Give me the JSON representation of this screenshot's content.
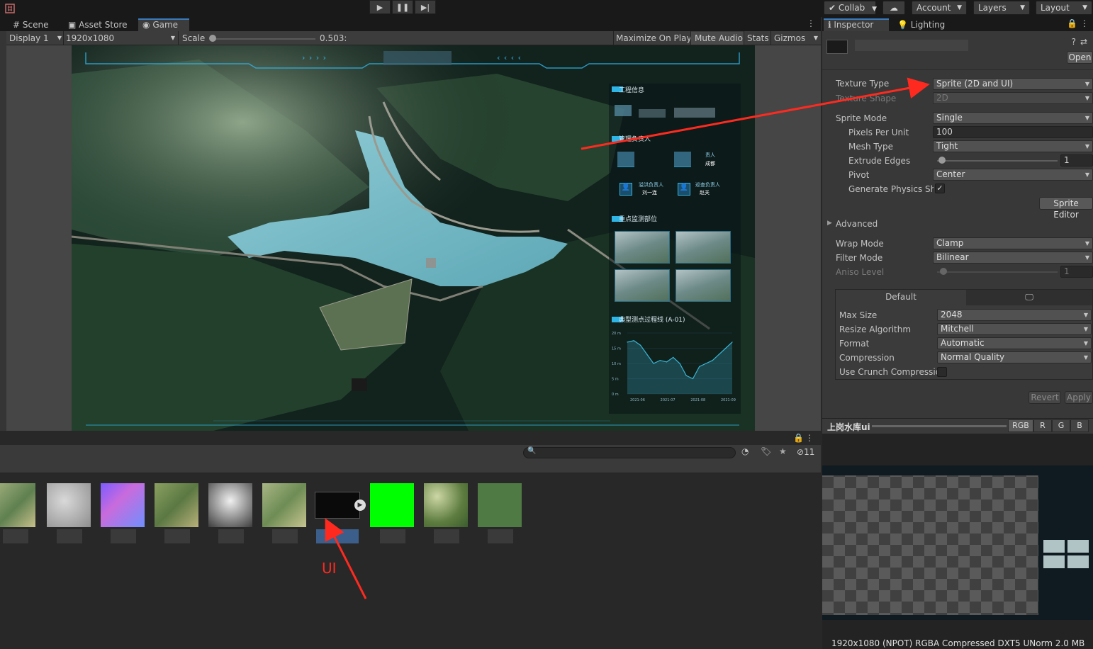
{
  "toolbar": {
    "collab_label": "Collab",
    "account_label": "Account",
    "layers_label": "Layers",
    "layout_label": "Layout",
    "play_icon": "play-icon",
    "pause_icon": "pause-icon",
    "step_icon": "step-icon"
  },
  "scene_tabs": {
    "scene": "Scene",
    "asset_store": "Asset Store",
    "game": "Game"
  },
  "game_bar": {
    "display": "Display 1",
    "resolution": "1920x1080",
    "scale_label": "Scale",
    "scale_value": 0.503,
    "scale_text": "0.503:",
    "maximize": "Maximize On Play",
    "mute": "Mute Audio",
    "stats": "Stats",
    "gizmos": "Gizmos"
  },
  "game_ui": {
    "panel1_title": "工程信息",
    "panel2_title": "管理负责人",
    "panel2_tail": "责人",
    "panel2_tail2": "成都",
    "person1_role": "溢洪负责人",
    "person1_name": "刘一连",
    "person2_role": "巡查负责人",
    "person2_name": "赵关",
    "panel3_title": "重点监测部位",
    "panel4_title": "典型测点过程线 (A-01)",
    "chart_y_ticks": [
      "20 m",
      "15 m",
      "10 m",
      "5 m",
      "0 m"
    ],
    "chart_x_ticks": [
      "2021-06",
      "2021-07",
      "2021-08",
      "2021-09"
    ],
    "header_left_arrows": "› › › ›",
    "header_right_arrows": "‹ ‹ ‹ ‹"
  },
  "chart_data": {
    "type": "area",
    "title": "典型测点过程线 (A-01)",
    "x": [
      "2021-06",
      "2021-07",
      "2021-08",
      "2021-09"
    ],
    "ylim": [
      0,
      20
    ],
    "y_ticks": [
      "20 m",
      "15 m",
      "10 m",
      "5 m",
      "0 m"
    ],
    "series": [
      {
        "values": [
          17,
          17.5,
          16,
          13,
          10,
          11,
          10.5,
          12,
          10,
          6,
          5,
          9,
          10,
          11,
          13,
          15,
          17
        ]
      }
    ],
    "color": "#3ab6d6"
  },
  "inspector_tabs": {
    "inspector": "Inspector",
    "lighting": "Lighting"
  },
  "inspector": {
    "open_label": "Open",
    "texture_type_label": "Texture Type",
    "texture_type_value": "Sprite (2D and UI)",
    "texture_shape_label": "Texture Shape",
    "texture_shape_value": "2D",
    "sprite_mode_label": "Sprite Mode",
    "sprite_mode_value": "Single",
    "ppu_label": "Pixels Per Unit",
    "ppu_value": "100",
    "mesh_type_label": "Mesh Type",
    "mesh_type_value": "Tight",
    "extrude_label": "Extrude Edges",
    "extrude_value": "1",
    "extrude_fraction": 0.03,
    "pivot_label": "Pivot",
    "pivot_value": "Center",
    "gen_physics_label": "Generate Physics Sha",
    "gen_physics_checked": true,
    "sprite_editor_label": "Sprite Editor",
    "advanced_label": "Advanced",
    "wrap_label": "Wrap Mode",
    "wrap_value": "Clamp",
    "filter_label": "Filter Mode",
    "filter_value": "Bilinear",
    "aniso_label": "Aniso Level",
    "aniso_value": "1",
    "aniso_fraction": 0.06,
    "platform_default": "Default",
    "max_size_label": "Max Size",
    "max_size_value": "2048",
    "resize_label": "Resize Algorithm",
    "resize_value": "Mitchell",
    "format_label": "Format",
    "format_value": "Automatic",
    "compression_label": "Compression",
    "compression_value": "Normal Quality",
    "crunch_label": "Use Crunch Compressio",
    "crunch_checked": false,
    "revert_label": "Revert",
    "apply_label": "Apply"
  },
  "preview": {
    "asset_name": "上岗水库ui",
    "channels": [
      "RGB",
      "R",
      "G",
      "B"
    ],
    "footer": "1920x1080 (NPOT)  RGBA Compressed DXT5 UNorm   2.0 MB"
  },
  "project": {
    "eye_count": "11",
    "annotation": "UI"
  },
  "colors": {
    "annotation_red": "#ff2a1f",
    "hud_cyan": "#2fb4e6",
    "unity_accent": "#3a79bb"
  }
}
